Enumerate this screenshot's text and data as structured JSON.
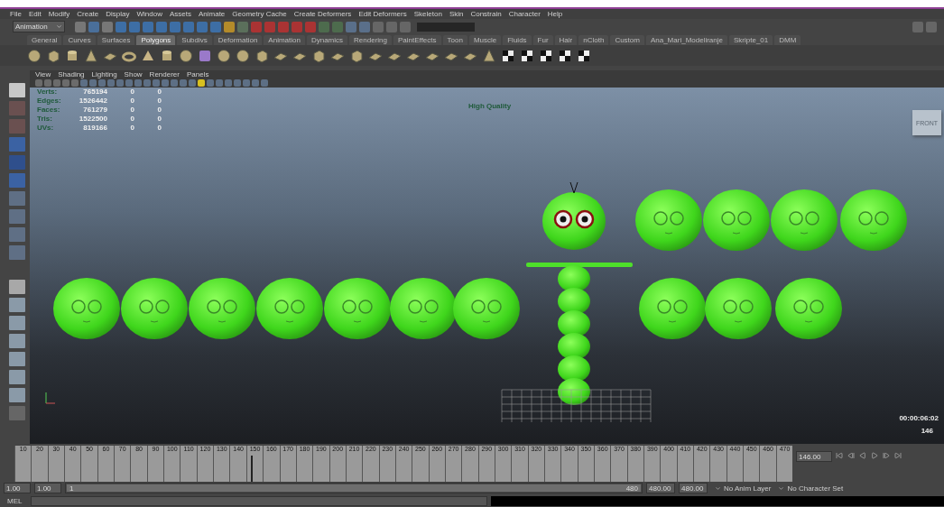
{
  "menu_bar": [
    "File",
    "Edit",
    "Modify",
    "Create",
    "Display",
    "Window",
    "Assets",
    "Animate",
    "Geometry Cache",
    "Create Deformers",
    "Edit Deformers",
    "Skeleton",
    "Skin",
    "Constrain",
    "Character",
    "Help"
  ],
  "status_line": {
    "mode": "Animation"
  },
  "shelf_tabs": [
    {
      "label": "General",
      "selected": false
    },
    {
      "label": "Curves",
      "selected": false
    },
    {
      "label": "Surfaces",
      "selected": false
    },
    {
      "label": "Polygons",
      "selected": true
    },
    {
      "label": "Subdivs",
      "selected": false
    },
    {
      "label": "Deformation",
      "selected": false
    },
    {
      "label": "Animation",
      "selected": false
    },
    {
      "label": "Dynamics",
      "selected": false
    },
    {
      "label": "Rendering",
      "selected": false
    },
    {
      "label": "PaintEffects",
      "selected": false
    },
    {
      "label": "Toon",
      "selected": false
    },
    {
      "label": "Muscle",
      "selected": false
    },
    {
      "label": "Fluids",
      "selected": false
    },
    {
      "label": "Fur",
      "selected": false
    },
    {
      "label": "Hair",
      "selected": false
    },
    {
      "label": "nCloth",
      "selected": false
    },
    {
      "label": "Custom",
      "selected": false
    },
    {
      "label": "Ana_Mari_Modeliranje",
      "selected": false
    },
    {
      "label": "Skripte_01",
      "selected": false
    },
    {
      "label": "DMM",
      "selected": false
    }
  ],
  "viewport": {
    "menus": [
      "View",
      "Shading",
      "Lighting",
      "Show",
      "Renderer",
      "Panels"
    ],
    "hud_stats": [
      {
        "label": "Verts:",
        "values": [
          "765194",
          "0",
          "0"
        ]
      },
      {
        "label": "Edges:",
        "values": [
          "1526442",
          "0",
          "0"
        ]
      },
      {
        "label": "Faces:",
        "values": [
          "761279",
          "0",
          "0"
        ]
      },
      {
        "label": "Tris:",
        "values": [
          "1522500",
          "0",
          "0"
        ]
      },
      {
        "label": "UVs:",
        "values": [
          "819166",
          "0",
          "0"
        ]
      }
    ],
    "quality": "High Quality",
    "view_cube": "FRONT",
    "timecode": "00:00:06:02",
    "frame": "146"
  },
  "timeline": {
    "ticks": [
      "10",
      "20",
      "30",
      "40",
      "50",
      "60",
      "70",
      "80",
      "90",
      "100",
      "110",
      "120",
      "130",
      "140",
      "150",
      "160",
      "170",
      "180",
      "190",
      "200",
      "210",
      "220",
      "230",
      "240",
      "250",
      "260",
      "270",
      "280",
      "290",
      "300",
      "310",
      "320",
      "330",
      "340",
      "350",
      "360",
      "370",
      "380",
      "390",
      "400",
      "410",
      "420",
      "430",
      "440",
      "450",
      "460",
      "470"
    ],
    "current_frame": "146.00",
    "level": 0.304
  },
  "range": {
    "level": 1,
    "start": "1.00",
    "inner_start": "1.00",
    "slider_start": "1",
    "slider_end": "480",
    "inner_end": "480.00",
    "end": "480.00",
    "anim_layer": "No Anim Layer",
    "character_set": "No Character Set"
  },
  "command_line": {
    "label": "MEL"
  }
}
